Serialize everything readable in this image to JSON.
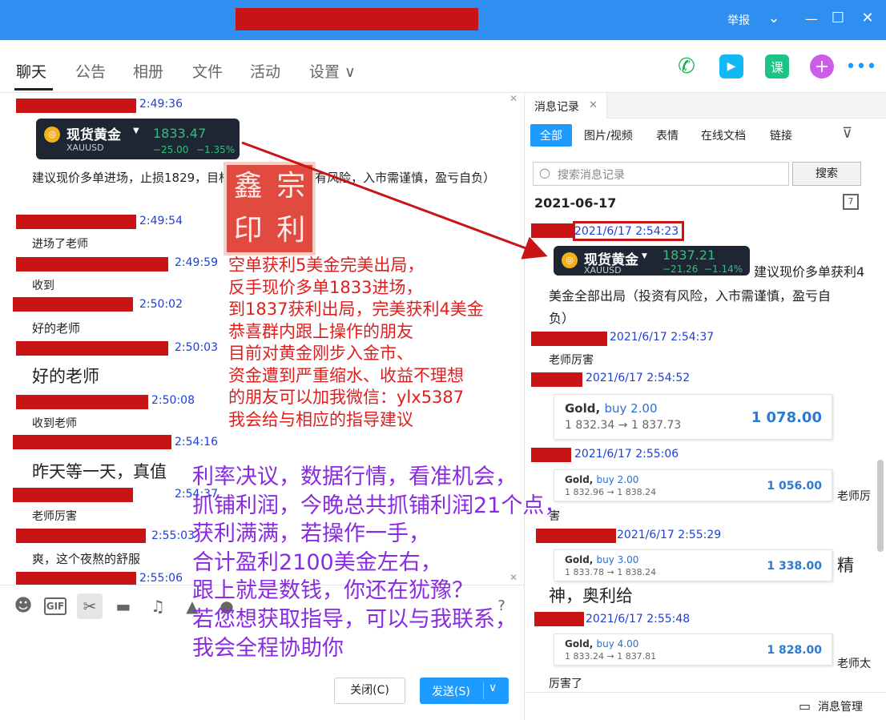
{
  "titlebar": {
    "report": "举报",
    "min_icon": "chevron-down-icon"
  },
  "tabs": [
    {
      "label": "聊天"
    },
    {
      "label": "公告"
    },
    {
      "label": "相册"
    },
    {
      "label": "文件"
    },
    {
      "label": "活动"
    },
    {
      "label": "设置 ∨"
    }
  ],
  "chat": {
    "messages": [
      {
        "time": "2:49:36"
      },
      {
        "text": "建议现价多单进场，止损1829，目标等我通知（投资有风险，入市需谨慎，盈亏自负）"
      },
      {
        "time": "2:49:54",
        "text": "进场了老师"
      },
      {
        "time": "2:49:59",
        "text": "收到"
      },
      {
        "time": "2:50:02",
        "text": "好的老师"
      },
      {
        "time": "2:50:03",
        "text": "好的老师"
      },
      {
        "time": "2:50:08",
        "text": "收到老师"
      },
      {
        "time": "2:54:16",
        "text": "昨天等一天，真值"
      },
      {
        "time": "2:54:37",
        "text": "老师厉害"
      },
      {
        "time": "2:55:03",
        "text": "爽，这个夜熬的舒服"
      },
      {
        "time": "2:55:06"
      }
    ],
    "stock": {
      "name": "现货黄金",
      "symbol": "XAUUSD",
      "price": "1833.47",
      "change": "−25.00",
      "pct": "−1.35%"
    },
    "seal_text": "鑫宗印利",
    "overlay_red": [
      "空单获利5美金完美出局，",
      "反手现价多单1833进场，",
      "到1837获利出局，完美获利4美金",
      "恭喜群内跟上操作的朋友",
      "目前对黄金刚步入金市、",
      "资金遭到严重缩水、收益不理想",
      "的朋友可以加我微信：ylx5387",
      "我会给与相应的指导建议"
    ],
    "overlay_purple": [
      "利率决议，数据行情，看准机会，",
      "抓铺利润，今晚总共抓铺利润21个点，",
      "获利满满，若操作一手，",
      "合计盈利2100美金左右，",
      "跟上就是数钱，你还在犹豫？",
      "若您想获取指导，可以与我联系，",
      "我会全程协助你"
    ],
    "close_button": "关闭(C)",
    "send_button": "发送(S)"
  },
  "panel": {
    "tab_label": "消息记录",
    "filters": [
      "全部",
      "图片/视频",
      "表情",
      "在线文档",
      "链接"
    ],
    "search_placeholder": "搜索消息记录",
    "search_button": "搜索",
    "date": "2021-06-17",
    "entries": [
      {
        "time": "2021/6/17 2:54:23",
        "text": "建议现价多单获利4",
        "text2": "美金全部出局（投资有风险，入市需谨慎，盈亏自",
        "text3": "负）"
      },
      {
        "time": "2021/6/17 2:54:37",
        "text": "老师厉害"
      },
      {
        "time": "2021/6/17 2:54:52"
      },
      {
        "time": "2021/6/17 2:55:06",
        "text": "老师厉",
        "text2": "害"
      },
      {
        "time": "2021/6/17 2:55:29",
        "text": "精",
        "text2": "神，奥利给"
      },
      {
        "time": "2021/6/17 2:55:48",
        "text": "老师太",
        "text2": "厉害了"
      }
    ],
    "stock": {
      "name": "现货黄金",
      "symbol": "XAUUSD",
      "price": "1837.21",
      "change": "−21.26",
      "pct": "−1.14%"
    },
    "cards": [
      {
        "title": "Gold,",
        "buy": "buy 2.00",
        "route": "1 832.34 → 1 837.73",
        "amount": "1 078.00"
      },
      {
        "title": "Gold,",
        "buy": "buy 2.00",
        "route": "1 832.96 → 1 838.24",
        "amount": "1 056.00"
      },
      {
        "title": "Gold,",
        "buy": "buy 3.00",
        "route": "1 833.78 → 1 838.24",
        "amount": "1 338.00"
      },
      {
        "title": "Gold,",
        "buy": "buy 4.00",
        "route": "1 833.24 → 1 837.81",
        "amount": "1 828.00"
      }
    ],
    "manager": "消息管理"
  }
}
